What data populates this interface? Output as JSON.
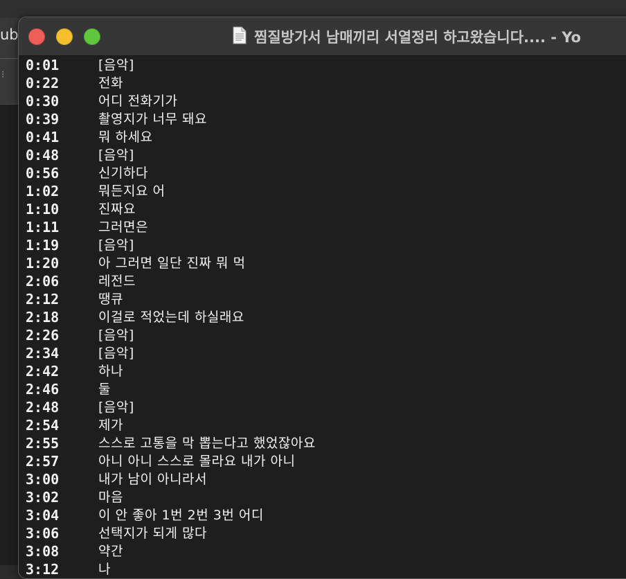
{
  "background_window": {
    "partial_title": "ub"
  },
  "window": {
    "title": "찜질방가서 남매끼리 서열정리 하고왔습니다.... - Yo",
    "document_icon": "document-icon",
    "controls": {
      "close": "close-button",
      "minimize": "minimize-button",
      "zoom": "zoom-button"
    }
  },
  "transcript": [
    {
      "time": "0:01",
      "text": "[음악]"
    },
    {
      "time": "0:22",
      "text": "전화"
    },
    {
      "time": "0:30",
      "text": "어디 전화기가"
    },
    {
      "time": "0:39",
      "text": "촬영지가 너무 돼요"
    },
    {
      "time": "0:41",
      "text": "뭐 하세요"
    },
    {
      "time": "0:48",
      "text": "[음악]"
    },
    {
      "time": "0:56",
      "text": "신기하다"
    },
    {
      "time": "1:02",
      "text": "뭐든지요 어"
    },
    {
      "time": "1:10",
      "text": "진짜요"
    },
    {
      "time": "1:11",
      "text": "그러면은"
    },
    {
      "time": "1:19",
      "text": "[음악]"
    },
    {
      "time": "1:20",
      "text": "아 그러면 일단 진짜 뭐 먹"
    },
    {
      "time": "2:06",
      "text": "레전드"
    },
    {
      "time": "2:12",
      "text": "땡큐"
    },
    {
      "time": "2:18",
      "text": "이걸로 적었는데 하실래요"
    },
    {
      "time": "2:26",
      "text": "[음악]"
    },
    {
      "time": "2:34",
      "text": "[음악]"
    },
    {
      "time": "2:42",
      "text": "하나"
    },
    {
      "time": "2:46",
      "text": "둘"
    },
    {
      "time": "2:48",
      "text": "[음악]"
    },
    {
      "time": "2:54",
      "text": "제가"
    },
    {
      "time": "2:55",
      "text": "스스로 고통을 막 뽑는다고 했었잖아요"
    },
    {
      "time": "2:57",
      "text": "아니 아니 스스로 몰라요 내가 아니"
    },
    {
      "time": "3:00",
      "text": "내가 남이 아니라서"
    },
    {
      "time": "3:02",
      "text": "마음"
    },
    {
      "time": "3:04",
      "text": "이 안 좋아 1번 2번 3번 어디"
    },
    {
      "time": "3:06",
      "text": "선택지가 되게 많다"
    },
    {
      "time": "3:08",
      "text": "약간"
    },
    {
      "time": "3:12",
      "text": "나"
    }
  ]
}
